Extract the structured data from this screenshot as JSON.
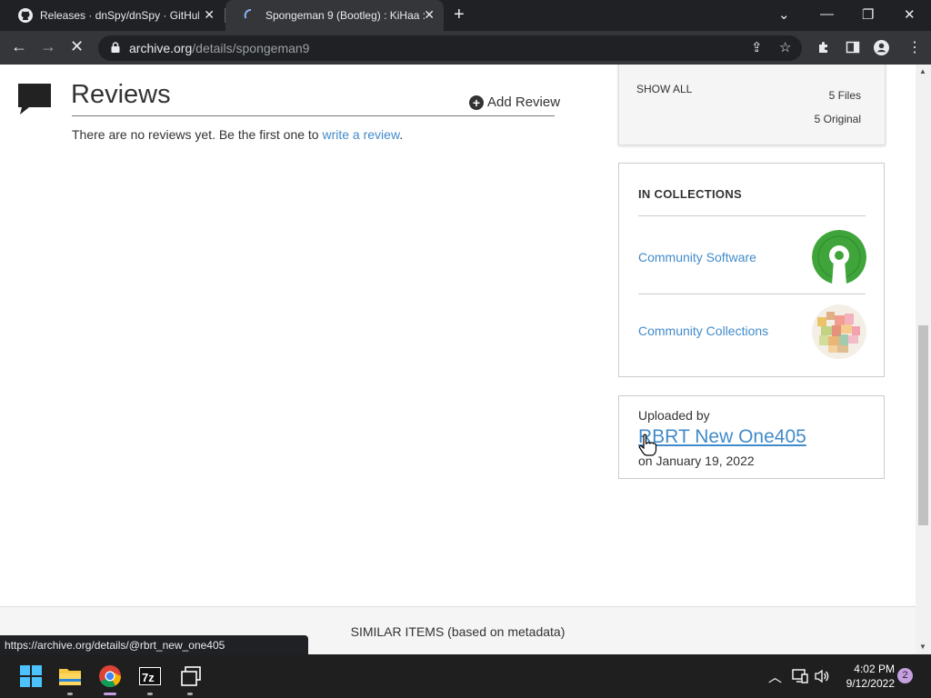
{
  "browser": {
    "tabs": [
      {
        "title": "Releases · dnSpy/dnSpy · GitHub",
        "icon": "github-icon",
        "active": false
      },
      {
        "title": "Spongeman 9 (Bootleg) : KiHaa :",
        "icon": "loading-spinner-icon",
        "active": true
      }
    ],
    "close_glyph": "✕",
    "new_tab_glyph": "+",
    "url_domain": "archive.org",
    "url_path": "/details/spongeman9",
    "status_link": "https://archive.org/details/@rbrt_new_one405"
  },
  "reviews": {
    "title": "Reviews",
    "add_label": "Add Review",
    "empty_text": "There are no reviews yet. Be the first one to ",
    "write_link": "write a review",
    "period": "."
  },
  "files": {
    "show_all": "SHOW ALL",
    "files_count": "5 Files",
    "original_count": "5 Original"
  },
  "collections": {
    "heading": "IN COLLECTIONS",
    "items": [
      {
        "label": "Community Software",
        "thumb_icon": "open-source-keyhole-icon"
      },
      {
        "label": "Community Collections",
        "thumb_icon": "mosaic-collection-icon"
      }
    ]
  },
  "uploader": {
    "label": "Uploaded by",
    "name": "RBRT New One405",
    "date": "on January 19, 2022"
  },
  "similar": {
    "label": "SIMILAR ITEMS (based on metadata)"
  },
  "taskbar": {
    "time": "4:02 PM",
    "date": "9/12/2022",
    "notification_count": "2",
    "apps": [
      "windows-start-icon",
      "file-explorer-icon",
      "chrome-icon",
      "7zip-icon",
      "task-view-icon"
    ]
  },
  "colors": {
    "link": "#428bca",
    "chrome_dark": "#202124",
    "chrome_tab": "#35363a",
    "accent_green": "#3fa53b"
  }
}
